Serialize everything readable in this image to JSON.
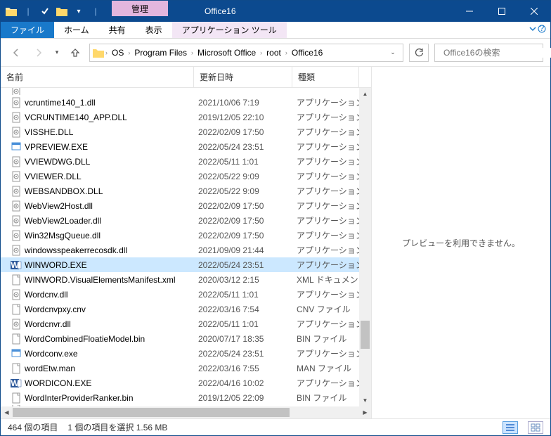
{
  "titlebar": {
    "contextual_label": "管理",
    "window_title": "Office16"
  },
  "ribbon": {
    "file": "ファイル",
    "home": "ホーム",
    "share": "共有",
    "view": "表示",
    "app_tools": "アプリケーション ツール"
  },
  "breadcrumb": {
    "items": [
      "OS",
      "Program Files",
      "Microsoft Office",
      "root",
      "Office16"
    ]
  },
  "search": {
    "placeholder": "Office16の検索"
  },
  "columns": {
    "name": "名前",
    "date": "更新日時",
    "type": "種類"
  },
  "files": [
    {
      "icon": "dll",
      "name": "vcruntime140_1.dll",
      "date": "2021/10/06 7:19",
      "type": "アプリケーション"
    },
    {
      "icon": "dll",
      "name": "VCRUNTIME140_APP.DLL",
      "date": "2019/12/05 22:10",
      "type": "アプリケーション"
    },
    {
      "icon": "dll",
      "name": "VISSHE.DLL",
      "date": "2022/02/09 17:50",
      "type": "アプリケーション"
    },
    {
      "icon": "exe",
      "name": "VPREVIEW.EXE",
      "date": "2022/05/24 23:51",
      "type": "アプリケーション"
    },
    {
      "icon": "dll",
      "name": "VVIEWDWG.DLL",
      "date": "2022/05/11 1:01",
      "type": "アプリケーション"
    },
    {
      "icon": "dll",
      "name": "VVIEWER.DLL",
      "date": "2022/05/22 9:09",
      "type": "アプリケーション"
    },
    {
      "icon": "dll",
      "name": "WEBSANDBOX.DLL",
      "date": "2022/05/22 9:09",
      "type": "アプリケーション"
    },
    {
      "icon": "dll",
      "name": "WebView2Host.dll",
      "date": "2022/02/09 17:50",
      "type": "アプリケーション"
    },
    {
      "icon": "dll",
      "name": "WebView2Loader.dll",
      "date": "2022/02/09 17:50",
      "type": "アプリケーション"
    },
    {
      "icon": "dll",
      "name": "Win32MsgQueue.dll",
      "date": "2022/02/09 17:50",
      "type": "アプリケーション"
    },
    {
      "icon": "dll",
      "name": "windowsspeakerrecosdk.dll",
      "date": "2021/09/09 21:44",
      "type": "アプリケーション"
    },
    {
      "icon": "word",
      "name": "WINWORD.EXE",
      "date": "2022/05/24 23:51",
      "type": "アプリケーション",
      "selected": true
    },
    {
      "icon": "file",
      "name": "WINWORD.VisualElementsManifest.xml",
      "date": "2020/03/12 2:15",
      "type": "XML ドキュメン"
    },
    {
      "icon": "dll",
      "name": "Wordcnv.dll",
      "date": "2022/05/11 1:01",
      "type": "アプリケーション"
    },
    {
      "icon": "file",
      "name": "Wordcnvpxy.cnv",
      "date": "2022/03/16 7:54",
      "type": "CNV ファイル"
    },
    {
      "icon": "dll",
      "name": "Wordcnvr.dll",
      "date": "2022/05/11 1:01",
      "type": "アプリケーション"
    },
    {
      "icon": "file",
      "name": "WordCombinedFloatieModel.bin",
      "date": "2020/07/17 18:35",
      "type": "BIN ファイル"
    },
    {
      "icon": "exe",
      "name": "Wordconv.exe",
      "date": "2022/05/24 23:51",
      "type": "アプリケーション"
    },
    {
      "icon": "file",
      "name": "wordEtw.man",
      "date": "2022/03/16 7:55",
      "type": "MAN ファイル"
    },
    {
      "icon": "word",
      "name": "WORDICON.EXE",
      "date": "2022/04/16 10:02",
      "type": "アプリケーション"
    },
    {
      "icon": "file",
      "name": "WordInterProviderRanker.bin",
      "date": "2019/12/05 22:09",
      "type": "BIN ファイル"
    }
  ],
  "preview": {
    "empty_text": "プレビューを利用できません。"
  },
  "status": {
    "item_count": "464 個の項目",
    "selected": "1 個の項目を選択 1.56 MB"
  }
}
